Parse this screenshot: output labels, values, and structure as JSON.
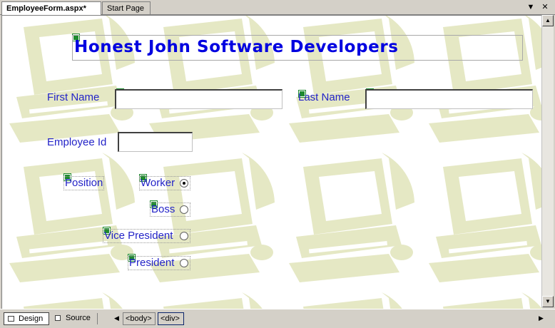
{
  "tabs": [
    {
      "label": "EmployeeForm.aspx*",
      "active": true
    },
    {
      "label": "Start Page",
      "active": false
    }
  ],
  "window_controls": {
    "dropdown": "▼",
    "close": "✕"
  },
  "page": {
    "title": "Honest John Software Developers",
    "first_name": {
      "label": "First Name",
      "value": ""
    },
    "last_name": {
      "label": "Last Name",
      "value": ""
    },
    "employee_id": {
      "label": "Employee Id",
      "value": ""
    },
    "position": {
      "label": "Position",
      "options": [
        {
          "label": "Worker",
          "checked": true
        },
        {
          "label": "Boss",
          "checked": false
        },
        {
          "label": "Vice President",
          "checked": false
        },
        {
          "label": "President",
          "checked": false
        }
      ]
    }
  },
  "status_bar": {
    "design_label": "Design",
    "source_label": "Source",
    "tags": [
      "<body>",
      "<div>"
    ]
  },
  "colors": {
    "label_text": "#2323c8",
    "title_text": "#0000e0",
    "pattern": "#e5e8c4"
  },
  "icons": {
    "designer_glyph": "green-square-glyph",
    "pattern": "computer-clipart-icon"
  }
}
